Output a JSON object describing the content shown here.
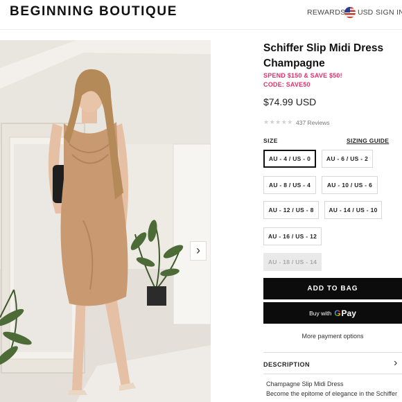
{
  "header": {
    "logo": "BEGINNING BOUTIQUE",
    "rewards": "REWARDS",
    "currency": "USD",
    "sign_in": "SIGN IN"
  },
  "product": {
    "title": "Schiffer Slip Midi Dress Champagne",
    "promo_line1": "SPEND $150 & SAVE $50!",
    "promo_line2": "CODE: SAVE50",
    "price": "$74.99 USD",
    "rating_stars": "★★★★★",
    "reviews": "437 Reviews"
  },
  "size": {
    "label": "SIZE",
    "guide": "SIZING GUIDE",
    "options": [
      {
        "label": "AU - 4 / US - 0",
        "state": "selected"
      },
      {
        "label": "AU - 6 / US - 2",
        "state": "available"
      },
      {
        "label": "AU - 8 / US - 4",
        "state": "available"
      },
      {
        "label": "AU - 10 / US - 6",
        "state": "available"
      },
      {
        "label": "AU - 12 / US - 8",
        "state": "available"
      },
      {
        "label": "AU - 14 / US - 10",
        "state": "available"
      },
      {
        "label": "AU - 16 / US - 12",
        "state": "available"
      },
      {
        "label": "AU - 18 / US - 14",
        "state": "sold-out"
      }
    ]
  },
  "actions": {
    "add_to_bag": "ADD TO BAG",
    "gpay_prefix": "Buy with",
    "gpay_brand": "Pay",
    "more_payment": "More payment options"
  },
  "description": {
    "heading": "DESCRIPTION",
    "line1": "Champagne Slip Midi Dress",
    "line2": "Become the epitome of elegance in the Schiffer"
  },
  "icons": {
    "next_arrow": "chevron-right-icon",
    "flag": "us-flag-icon",
    "description_toggle": "chevron-right-icon"
  },
  "colors": {
    "promo": "#e0306a",
    "button": "#0c0c0c",
    "dress": "#c99a72"
  }
}
